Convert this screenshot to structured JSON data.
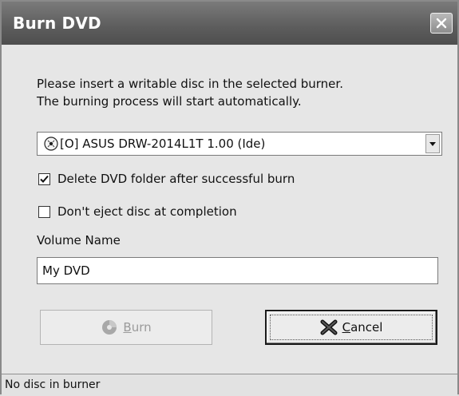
{
  "window": {
    "title": "Burn DVD"
  },
  "message": {
    "line1": "Please insert a writable disc in the selected burner.",
    "line2": "The burning process will start automatically."
  },
  "burner_select": {
    "selected": "[O] ASUS DRW-2014L1T 1.00 (Ide)",
    "icon": "disc-drive-icon"
  },
  "options": {
    "delete_folder": {
      "label": "Delete DVD folder after successful burn",
      "checked": true
    },
    "dont_eject": {
      "label": "Don't eject disc at completion",
      "checked": false
    }
  },
  "volume": {
    "label": "Volume Name",
    "value": "My DVD"
  },
  "buttons": {
    "burn": {
      "first": "B",
      "rest": "urn",
      "enabled": false,
      "icon": "burn-disc-icon"
    },
    "cancel": {
      "first": "C",
      "rest": "ancel",
      "enabled": true,
      "icon": "cancel-x-icon"
    }
  },
  "status": {
    "text": "No disc in burner"
  }
}
